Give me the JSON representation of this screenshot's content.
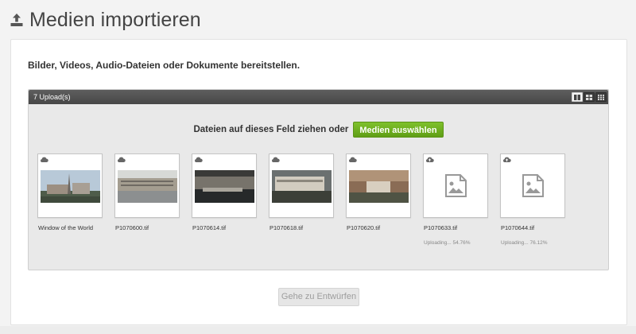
{
  "header": {
    "title": "Medien importieren",
    "icon": "upload-icon"
  },
  "intro_text": "Bilder, Videos, Audio-Dateien oder Dokumente bereitstellen.",
  "panel": {
    "count_label": "7 Upload(s)",
    "view_modes": [
      "list-view-icon",
      "grid-view-icon",
      "small-grid-view-icon"
    ],
    "drop_text": "Dateien auf dieses Feld ziehen oder",
    "select_button": "Medien auswählen",
    "accent_color": "#6aab1f"
  },
  "uploads": [
    {
      "name": "Window of the World",
      "status": "",
      "has_thumb": true,
      "progress_percent": 100
    },
    {
      "name": "P1070600.tif",
      "status": "",
      "has_thumb": true,
      "progress_percent": 100
    },
    {
      "name": "P1070614.tif",
      "status": "",
      "has_thumb": true,
      "progress_percent": 100
    },
    {
      "name": "P1070618.tif",
      "status": "",
      "has_thumb": true,
      "progress_percent": 100
    },
    {
      "name": "P1070620.tif",
      "status": "",
      "has_thumb": true,
      "progress_percent": 100
    },
    {
      "name": "P1070633.tif",
      "status": "Uploading... 54.76%",
      "has_thumb": false,
      "progress_percent": 54.76
    },
    {
      "name": "P1070644.tif",
      "status": "Uploading... 76.12%",
      "has_thumb": false,
      "progress_percent": 76.12
    }
  ],
  "footer": {
    "drafts_button": "Gehe zu Entwürfen"
  }
}
